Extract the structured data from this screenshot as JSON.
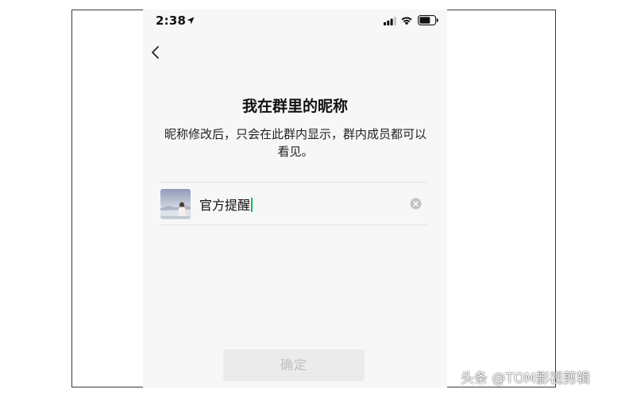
{
  "status_bar": {
    "time": "2:38"
  },
  "page": {
    "title": "我在群里的昵称",
    "subtitle": "昵称修改后，只会在此群内显示，群内成员都可以看见。"
  },
  "nickname": {
    "value": "官方提醒"
  },
  "confirm": {
    "label": "确定"
  },
  "watermark": {
    "text": "头条 @TOM影视剪辑"
  },
  "colors": {
    "accent": "#07c160",
    "disabled_button_bg": "#ebebeb",
    "disabled_button_text": "#bfbfbf"
  },
  "icons": [
    "location-arrow-icon",
    "signal-icon",
    "wifi-icon",
    "battery-icon",
    "back-chevron-icon",
    "clear-icon"
  ]
}
